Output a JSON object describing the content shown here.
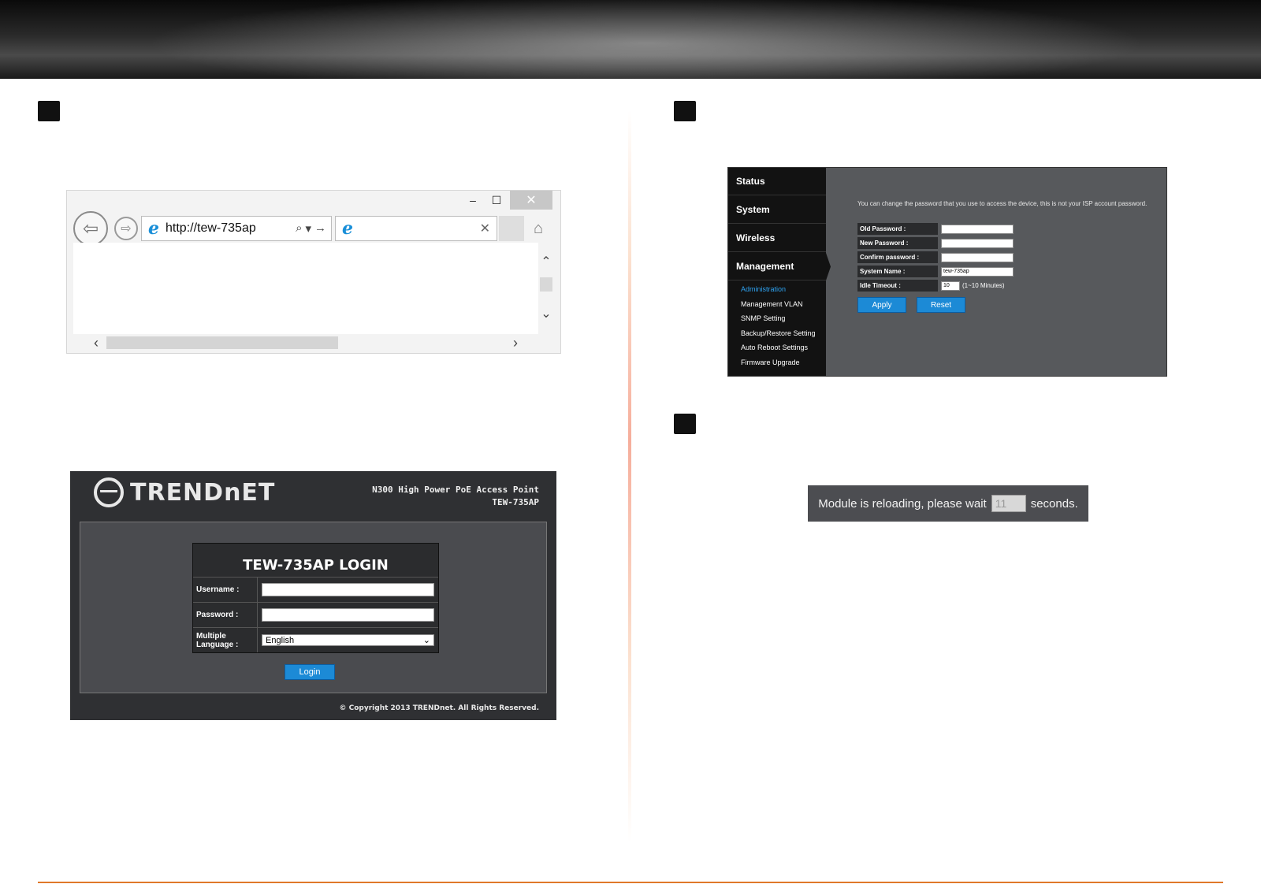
{
  "browser": {
    "win_min": "‒",
    "win_max": "☐",
    "win_close": "✕",
    "back": "⇦",
    "forward": "⇨",
    "url": "http://tew-735ap",
    "ie_glyph": "e",
    "search_glyph": "⌕",
    "dropdown_glyph": "▾",
    "go_glyph": "→",
    "tab_close": "✕",
    "home_glyph": "⌂",
    "scroll_up": "⌃",
    "scroll_down": "⌄",
    "scroll_left": "‹",
    "scroll_right": "›"
  },
  "login": {
    "brand": "TRENDnET",
    "product_line1": "N300 High Power PoE Access Point",
    "product_line2": "TEW-735AP",
    "title": "TEW-735AP LOGIN",
    "username_label": "Username :",
    "password_label": "Password :",
    "language_label_1": "Multiple",
    "language_label_2": "Language :",
    "language_value": "English",
    "login_button": "Login",
    "copyright": "© Copyright 2013 TRENDnet. All Rights Reserved."
  },
  "admin": {
    "menu": [
      "Status",
      "System",
      "Wireless",
      "Management"
    ],
    "submenu": [
      "Administration",
      "Management VLAN",
      "SNMP Setting",
      "Backup/Restore Setting",
      "Auto Reboot Settings",
      "Firmware Upgrade"
    ],
    "description": "You can change the password that you use to access the device, this is not your ISP account password.",
    "fields": [
      {
        "label": "Old Password :",
        "value": ""
      },
      {
        "label": "New Password :",
        "value": ""
      },
      {
        "label": "Confirm password :",
        "value": ""
      },
      {
        "label": "System Name :",
        "value": "tew-735ap"
      },
      {
        "label": "Idle Timeout :",
        "value": "10"
      }
    ],
    "idle_note": "(1~10 Minutes)",
    "apply_button": "Apply",
    "reset_button": "Reset"
  },
  "reload": {
    "prefix": "Module is reloading, please wait",
    "count": "11",
    "suffix": "seconds."
  },
  "colors": {
    "accent_blue": "#1c8ad6",
    "active_submenu": "#2ea3f2",
    "footer_orange": "#e0782a"
  }
}
